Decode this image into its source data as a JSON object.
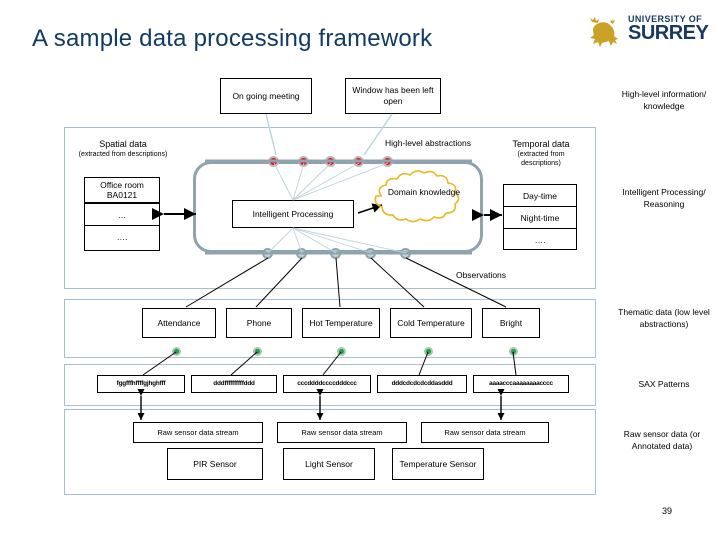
{
  "slide": {
    "title": "A sample data processing framework",
    "page_number": "39",
    "logo": {
      "line1": "UNIVERSITY OF",
      "line2": "SURREY",
      "icon": "stag-icon"
    }
  },
  "callouts": [
    {
      "text": "On going meeting"
    },
    {
      "text": "Window has been left open"
    }
  ],
  "side_labels": [
    {
      "text": "High-level information/ knowledge"
    },
    {
      "text": "Intelligent Processing/ Reasoning"
    },
    {
      "text": "Thematic data (low level abstractions)"
    },
    {
      "text": "SAX Patterns"
    },
    {
      "text": "Raw sensor data (or Annotated data)"
    }
  ],
  "reasoning_panel": {
    "spatial": {
      "title": "Spatial data",
      "subtitle": "(extracted from descriptions)",
      "rows": [
        "Office room BA0121",
        "…",
        "…."
      ]
    },
    "temporal": {
      "title": "Temporal data",
      "subtitle": "(extracted from descriptions)",
      "rows": [
        "Day-time",
        "Night-time",
        "…."
      ]
    },
    "processing_box": "Intelligent Processing",
    "domain_cloud": "Domain knowledge",
    "abstractions_label": "High-level abstractions",
    "observations_label": "Observations",
    "red_dot_count": 5,
    "blue_dot_count": 5
  },
  "thematic": {
    "items": [
      "Attendance",
      "Phone",
      "Hot Temperature",
      "Cold Temperature",
      "Bright"
    ],
    "green_dot_count": 5
  },
  "sax": {
    "patterns": [
      "fggfffhffffgjhghfff",
      "dddffffffffffddd",
      "cccddddccccdddccc",
      "dddcdcdcdcddasddd",
      "aaaacccaaaaaaaacccc"
    ]
  },
  "raw": {
    "streams": [
      "Raw sensor data stream",
      "Raw sensor data stream",
      "Raw sensor data stream"
    ],
    "sensors": [
      "PIR Sensor",
      "Light Sensor",
      "Temperature Sensor"
    ]
  },
  "colors": {
    "title": "#123B63",
    "panel_border": "#A9BFCF",
    "red_dot": "#E8121B",
    "blue_dot": "#BBD4DC",
    "green_dot": "#1F9D55",
    "cloud": "#E8B825",
    "ring": "#8FA3AE"
  }
}
